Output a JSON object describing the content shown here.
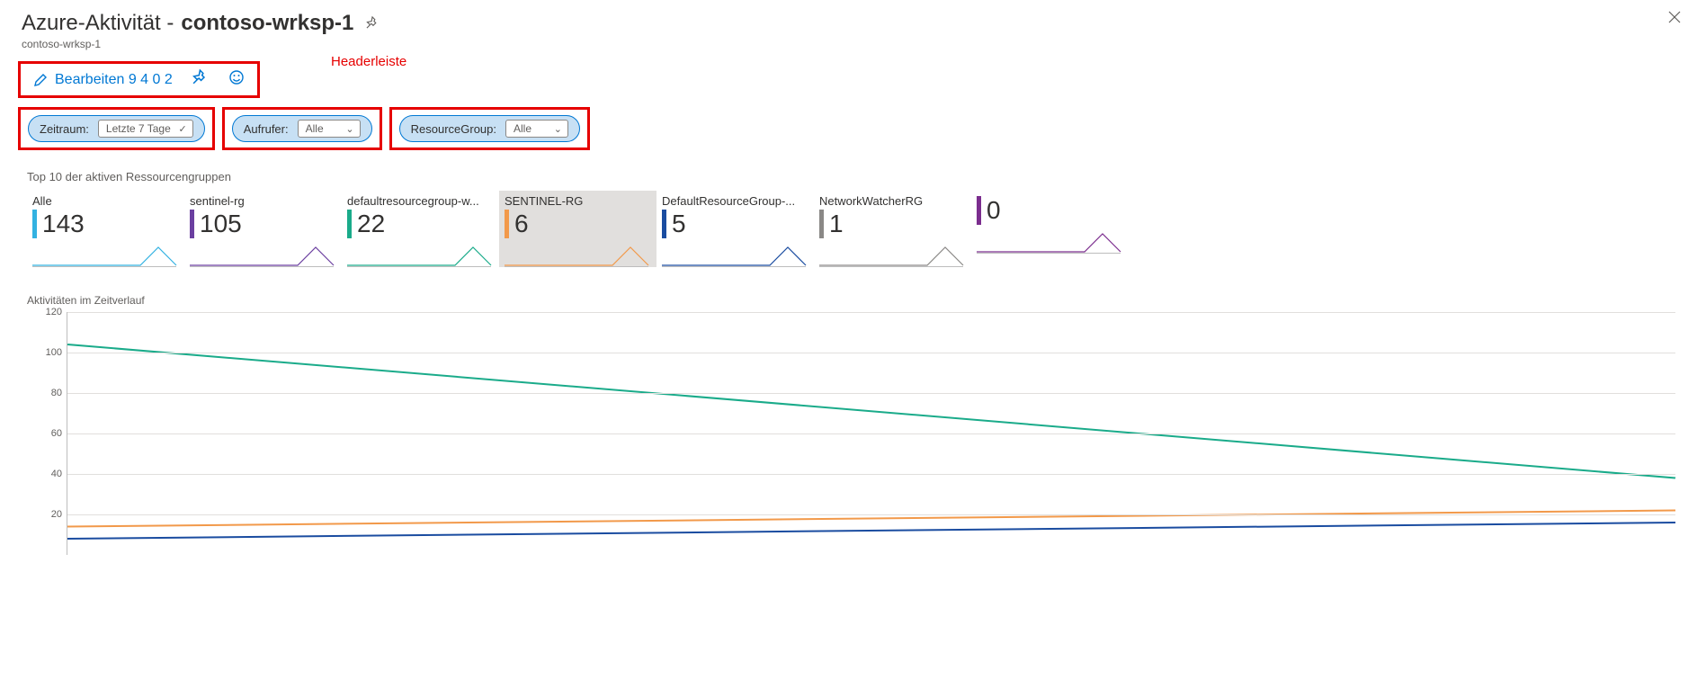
{
  "header": {
    "title_prefix": "Azure-Aktivität - ",
    "title_bold": "contoso-wrksp-1",
    "breadcrumb": "contoso-wrksp-1"
  },
  "toolbar": {
    "edit_label": "Bearbeiten 9 4 0 2",
    "annotation": "Headerleiste"
  },
  "filters": {
    "time": {
      "label": "Zeitraum:",
      "value": "Letzte 7 Tage"
    },
    "caller": {
      "label": "Aufrufer:",
      "value": "Alle"
    },
    "rg": {
      "label": "ResourceGroup:",
      "value": "Alle"
    }
  },
  "sections": {
    "tiles_title": "Top 10 der aktiven Ressourcengruppen",
    "chart_title": "Aktivitäten im Zeitverlauf"
  },
  "tiles": [
    {
      "label": "Alle",
      "value": "143",
      "color": "#33b2e1",
      "selected": false
    },
    {
      "label": "sentinel-rg",
      "value": "105",
      "color": "#6b3fa0",
      "selected": false
    },
    {
      "label": "defaultresourcegroup-w...",
      "value": "22",
      "color": "#1aab8a",
      "selected": false
    },
    {
      "label": "SENTINEL-RG",
      "value": "6",
      "color": "#f2994a",
      "selected": true
    },
    {
      "label": "DefaultResourceGroup-...",
      "value": "5",
      "color": "#1a4ca0",
      "selected": false
    },
    {
      "label": "NetworkWatcherRG",
      "value": "1",
      "color": "#8a8886",
      "selected": false
    },
    {
      "label": "",
      "value": "0",
      "color": "#7b2d8e",
      "selected": false
    }
  ],
  "chart_data": {
    "type": "line",
    "ylabel": "",
    "xlabel": "",
    "ylim": [
      0,
      120
    ],
    "y_ticks": [
      20,
      40,
      60,
      80,
      100,
      120
    ],
    "x": [
      0,
      1
    ],
    "series": [
      {
        "name": "Alle",
        "color": "#1aab8a",
        "values": [
          104,
          38
        ]
      },
      {
        "name": "sentinel-rg",
        "color": "#f2994a",
        "values": [
          14,
          22
        ]
      },
      {
        "name": "defaultresourcegroup-w...",
        "color": "#1a4ca0",
        "values": [
          8,
          16
        ]
      }
    ]
  }
}
